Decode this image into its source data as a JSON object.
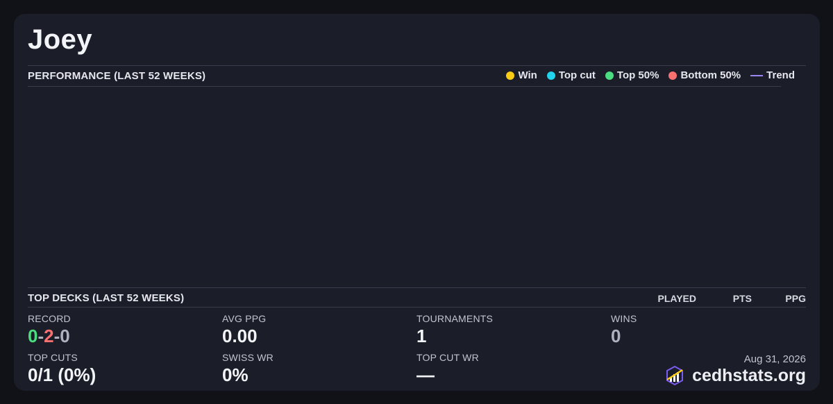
{
  "player": {
    "name": "Joey"
  },
  "performance": {
    "title": "PERFORMANCE (LAST 52 WEEKS)",
    "legend": [
      {
        "label": "Win",
        "color": "#facc15",
        "marker": "dot"
      },
      {
        "label": "Top cut",
        "color": "#22d3ee",
        "marker": "dot"
      },
      {
        "label": "Top 50%",
        "color": "#4ade80",
        "marker": "dot"
      },
      {
        "label": "Bottom 50%",
        "color": "#f87171",
        "marker": "dot"
      },
      {
        "label": "Trend",
        "color": "#9b86f2",
        "marker": "line"
      }
    ]
  },
  "top_decks": {
    "title": "TOP DECKS (LAST 52 WEEKS)",
    "columns": [
      "PLAYED",
      "PTS",
      "PPG"
    ]
  },
  "stats": {
    "record": {
      "label": "RECORD",
      "wins": "0",
      "losses": "2",
      "draws": "0",
      "sep": "-"
    },
    "avg_ppg": {
      "label": "AVG PPG",
      "value": "0.00"
    },
    "tournaments": {
      "label": "TOURNAMENTS",
      "value": "1"
    },
    "wins": {
      "label": "WINS",
      "value": "0"
    },
    "top_cuts": {
      "label": "TOP CUTS",
      "value": "0/1 (0%)"
    },
    "swiss_wr": {
      "label": "SWISS WR",
      "value": "0%"
    },
    "top_cut_wr": {
      "label": "TOP CUT WR",
      "value": "—"
    }
  },
  "footer": {
    "date": "Aug 31, 2026",
    "brand": "cedhstats.org",
    "logo_icon": "cedhstats-chart-logo-icon"
  }
}
